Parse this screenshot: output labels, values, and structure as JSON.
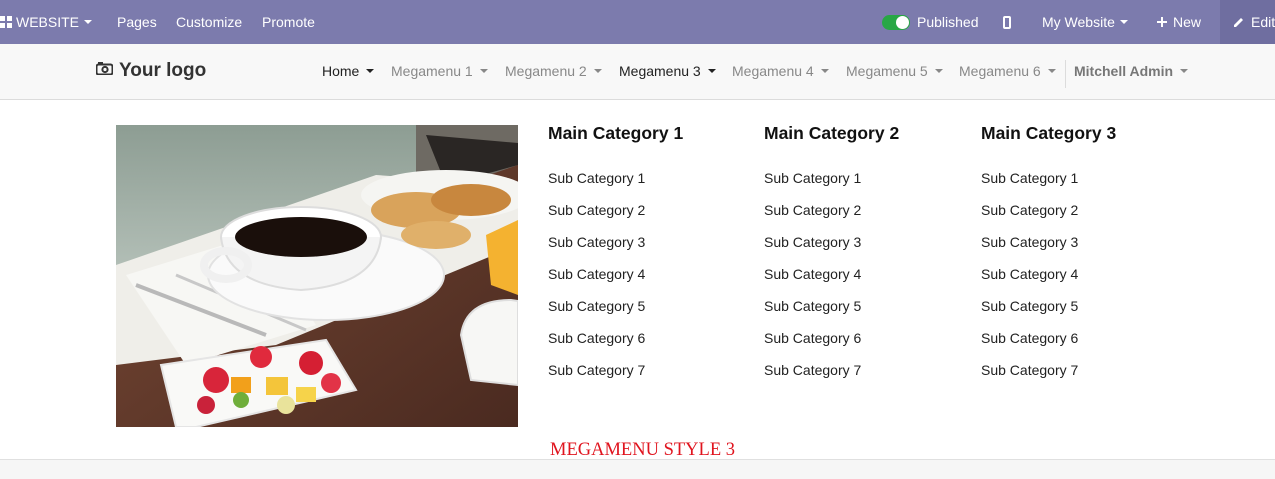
{
  "admin_bar": {
    "website_label": "WEBSITE",
    "pages_label": "Pages",
    "customize_label": "Customize",
    "promote_label": "Promote",
    "published_label": "Published",
    "my_website_label": "My Website",
    "new_label": "New",
    "edit_label": "Edit",
    "bar_color": "#7c7bad",
    "toggle_color": "#28a745"
  },
  "navbar": {
    "logo_text": "Your logo",
    "items": [
      {
        "label": "Home"
      },
      {
        "label": "Megamenu 1"
      },
      {
        "label": "Megamenu 2"
      },
      {
        "label": "Megamenu 3"
      },
      {
        "label": "Megamenu 4"
      },
      {
        "label": "Megamenu 5"
      },
      {
        "label": "Megamenu 6"
      }
    ],
    "user_label": "Mitchell Admin"
  },
  "megamenu": {
    "columns": [
      {
        "title": "Main Category 1",
        "items": [
          "Sub Category 1",
          "Sub Category 2",
          "Sub Category 3",
          "Sub Category 4",
          "Sub Category 5",
          "Sub Category 6",
          "Sub Category 7"
        ]
      },
      {
        "title": "Main Category 2",
        "items": [
          "Sub Category 1",
          "Sub Category 2",
          "Sub Category 3",
          "Sub Category 4",
          "Sub Category 5",
          "Sub Category 6",
          "Sub Category 7"
        ]
      },
      {
        "title": "Main Category 3",
        "items": [
          "Sub Category 1",
          "Sub Category 2",
          "Sub Category 3",
          "Sub Category 4",
          "Sub Category 5",
          "Sub Category 6",
          "Sub Category 7"
        ]
      }
    ],
    "style_label": "MEGAMENU STYLE 3",
    "style_label_color": "#e0141e"
  }
}
